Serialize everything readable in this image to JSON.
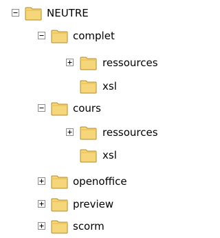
{
  "tree": {
    "nodes": [
      {
        "label": "NEUTRE",
        "toggle": "expanded",
        "level": 0
      },
      {
        "label": "complet",
        "toggle": "expanded",
        "level": 1
      },
      {
        "label": "ressources",
        "toggle": "collapsed",
        "level": 2
      },
      {
        "label": "xsl",
        "toggle": "none",
        "level": 2
      },
      {
        "label": "cours",
        "toggle": "expanded",
        "level": 1
      },
      {
        "label": "ressources",
        "toggle": "collapsed",
        "level": 2
      },
      {
        "label": "xsl",
        "toggle": "none",
        "level": 2
      },
      {
        "label": "openoffice",
        "toggle": "collapsed",
        "level": 1
      },
      {
        "label": "preview",
        "toggle": "collapsed",
        "level": 1
      },
      {
        "label": "scorm",
        "toggle": "collapsed",
        "level": 1
      }
    ]
  },
  "colors": {
    "folder_fill": "#f6d67a",
    "folder_edge": "#b48b28",
    "folder_tab": "#eec35a",
    "toggle_border": "#8c8c8c"
  }
}
